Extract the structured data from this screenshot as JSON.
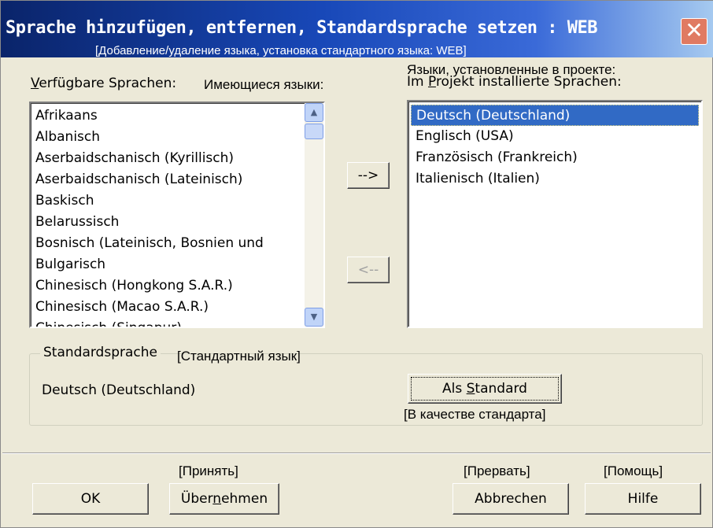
{
  "window": {
    "title": "Sprache hinzufügen, entfernen, Standardsprache setzen : WEB",
    "title_translation": "[Добавление/удаление языка, установка стандартного языка: WEB]",
    "close_label": "✕"
  },
  "available": {
    "label": "Verfügbare Sprachen:",
    "label_translation": "Имеющиеся языки:",
    "items": [
      "Afrikaans",
      "Albanisch",
      "Aserbaidschanisch (Kyrillisch)",
      "Aserbaidschanisch (Lateinisch)",
      "Baskisch",
      "Belarussisch",
      "Bosnisch (Lateinisch, Bosnien und",
      "Bulgarisch",
      "Chinesisch (Hongkong S.A.R.)",
      "Chinesisch (Macao S.A.R.)",
      "Chinesisch (Singapur)"
    ]
  },
  "installed": {
    "label": "Im Projekt installierte Sprachen:",
    "label_translation": "Языки, установленные в проекте:",
    "items": [
      "Deutsch (Deutschland)",
      "Englisch (USA)",
      "Französisch (Frankreich)",
      "Italienisch (Italien)"
    ],
    "selected_index": 0
  },
  "transfer": {
    "add_label": "-->",
    "remove_label": "<--"
  },
  "standard": {
    "legend": "Standardsprache",
    "legend_translation": "[Стандартный язык]",
    "value": "Deutsch (Deutschland)",
    "button_label": "Als Standard",
    "button_translation": "[В качестве стандарта]"
  },
  "footer": {
    "ok_label": "OK",
    "apply_label": "Übernehmen",
    "apply_translation": "[Принять]",
    "cancel_label": "Abbrechen",
    "cancel_translation": "[Прервать]",
    "help_label": "Hilfe",
    "help_translation": "[Помощь]"
  },
  "colors": {
    "dialog_bg": "#ece9d8",
    "title_gradient_start": "#0a246a",
    "selection": "#316ac5",
    "close_button": "#e07a62"
  }
}
